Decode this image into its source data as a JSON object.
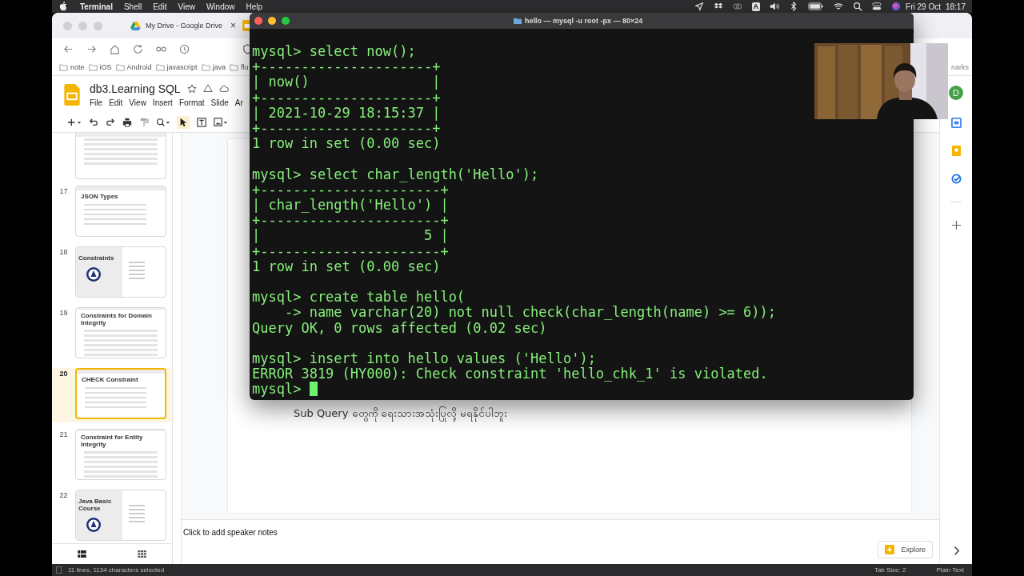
{
  "menubar": {
    "app": "Terminal",
    "menus": [
      "Shell",
      "Edit",
      "View",
      "Window",
      "Help"
    ],
    "input_source": "A",
    "date": "Fri 29 Oct",
    "time": "18:17"
  },
  "browser": {
    "tab": {
      "title": "My Drive - Google Drive",
      "close": "×"
    },
    "bookmarks": [
      "note",
      "iOS",
      "Android",
      "javascript",
      "java",
      "flu"
    ],
    "bookmarks_cut": "narks",
    "doc_title": "db3.Learning SQL",
    "menus": [
      "File",
      "Edit",
      "View",
      "Insert",
      "Format",
      "Slide",
      "Ar"
    ],
    "account": "D"
  },
  "slides": [
    {
      "kind": "table",
      "selected": false
    },
    {
      "number": "17",
      "title": "JSON Types",
      "kind": "text",
      "selected": false
    },
    {
      "number": "18",
      "title": "Constraints",
      "kind": "cover",
      "selected": false
    },
    {
      "number": "19",
      "title": "Constraints for Domain Integrity",
      "kind": "table",
      "selected": false
    },
    {
      "number": "20",
      "title": "CHECK Constraint",
      "kind": "text",
      "selected": true
    },
    {
      "number": "21",
      "title": "Constraint for Entity Integrity",
      "kind": "table",
      "selected": false
    },
    {
      "number": "22",
      "title": "Java Basic Course",
      "kind": "cover",
      "selected": false
    }
  ],
  "slide_text": "Sub Query တွေကို ရေးသားအသုံးပြုလို့ မရနိုင်ပါဘူး",
  "speaker_notes": {
    "placeholder": "Click to add speaker notes"
  },
  "explore": "Explore",
  "terminal": {
    "title": "hello — mysql -u root -px — 80×24",
    "blocks": [
      [
        {
          "text": "mysql> select now();"
        },
        {
          "text": "+---------------------+"
        },
        {
          "text": "| now()               |"
        },
        {
          "text": "+---------------------+"
        },
        {
          "text": "| 2021-10-29 18:15:37 |"
        },
        {
          "text": "+---------------------+"
        },
        {
          "text": "1 row in set (0.00 sec)"
        }
      ],
      [
        {
          "text": "mysql> select char_length('Hello');"
        },
        {
          "text": "+----------------------+"
        },
        {
          "text": "| char_length('Hello') |"
        },
        {
          "text": "+----------------------+"
        },
        {
          "text": "|                    5 |"
        },
        {
          "text": "+----------------------+"
        },
        {
          "text": "1 row in set (0.00 sec)"
        }
      ],
      [
        {
          "text": "mysql> create table hello("
        },
        {
          "text": "    -> name varchar(20) not null check(char_length(name) >= 6));"
        },
        {
          "text": "Query OK, 0 rows affected (0.02 sec)"
        }
      ],
      [
        {
          "text": "mysql> insert into hello values ('Hello');"
        },
        {
          "text": "ERROR 3819 (HY000): Check constraint 'hello_chk_1' is violated."
        },
        {
          "text": "mysql> ",
          "cursor": true
        }
      ]
    ]
  },
  "status_bar": {
    "selection": "11 lines, 1134 characters selected",
    "tab_size": "Tab Size: 2",
    "mode": "Plain Text"
  }
}
